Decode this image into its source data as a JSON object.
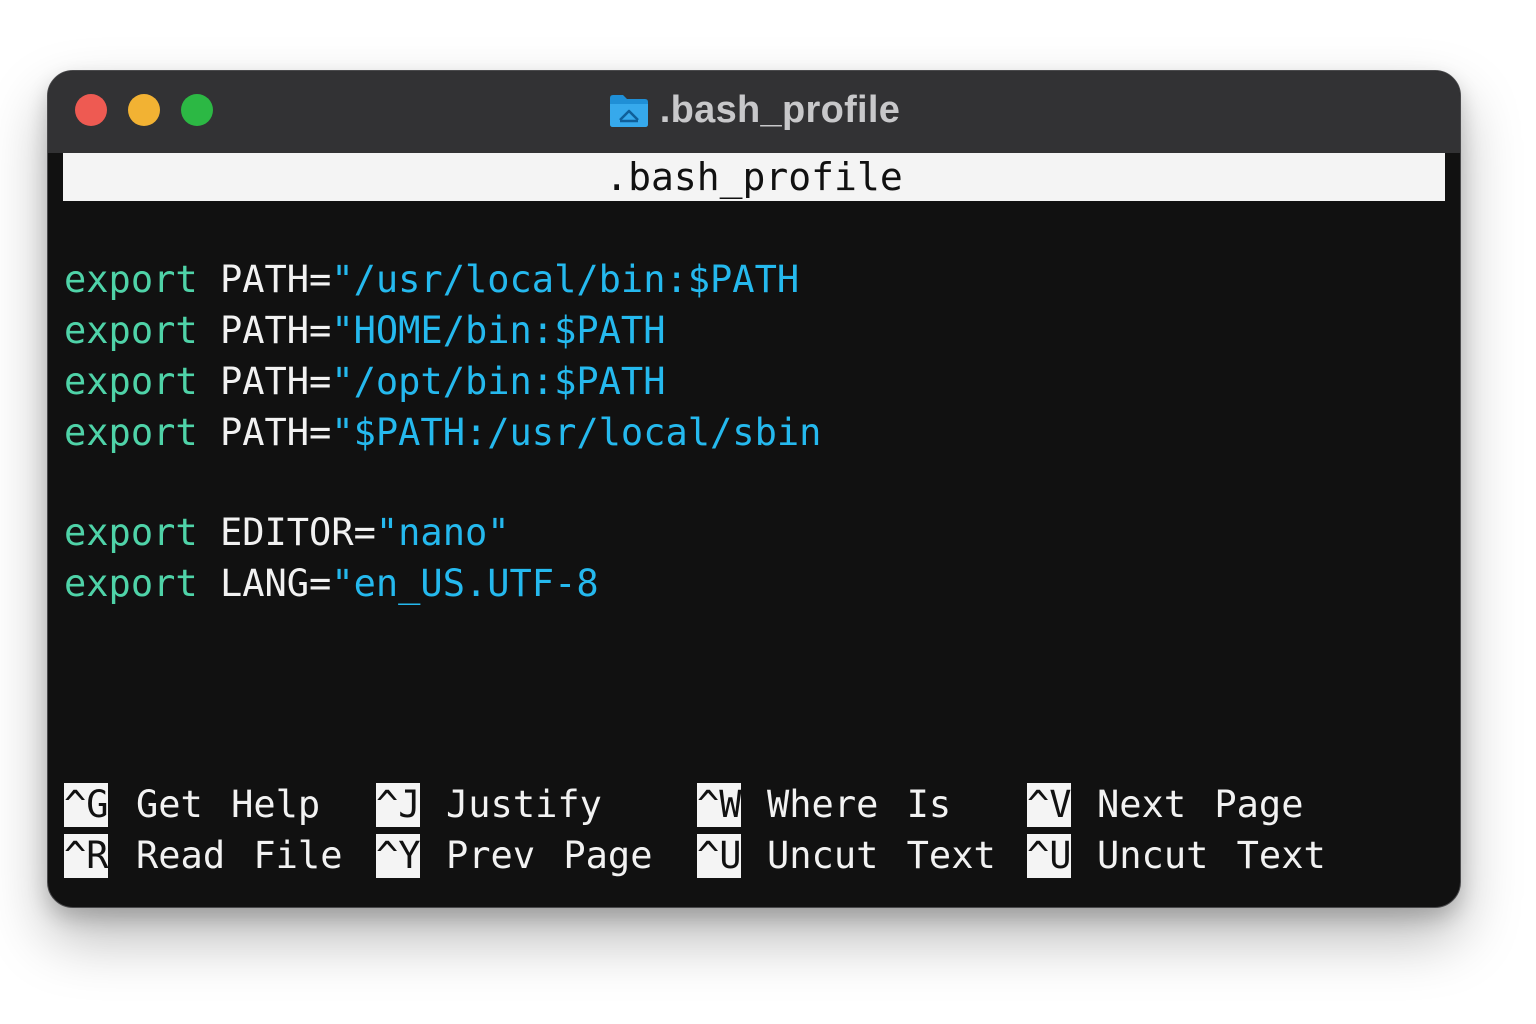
{
  "window": {
    "title": ".bash_profile",
    "folder_icon": "folder-icon"
  },
  "editor": {
    "header": ".bash_profile",
    "lines": [
      {
        "keyword": "export",
        "var": "PATH=",
        "value": "\"/usr/local/bin:$PATH"
      },
      {
        "keyword": "export",
        "var": "PATH=",
        "value": "\"HOME/bin:$PATH"
      },
      {
        "keyword": "export",
        "var": "PATH=",
        "value": "\"/opt/bin:$PATH"
      },
      {
        "keyword": "export",
        "var": "PATH=",
        "value": "\"$PATH:/usr/local/sbin"
      },
      {
        "keyword": "export",
        "var": "EDITOR=",
        "value": "\"nano\""
      },
      {
        "keyword": "export",
        "var": "LANG=",
        "value": "\"en_US.UTF-8"
      }
    ]
  },
  "shortcuts": [
    [
      {
        "key": "^G",
        "label": "Get Help"
      },
      {
        "key": "^J",
        "label": "Justify"
      },
      {
        "key": "^W",
        "label": "Where Is"
      },
      {
        "key": "^V",
        "label": "Next Page"
      }
    ],
    [
      {
        "key": "^R",
        "label": "Read File"
      },
      {
        "key": "^Y",
        "label": "Prev Page"
      },
      {
        "key": "^U",
        "label": "Uncut Text"
      },
      {
        "key": "^U",
        "label": "Uncut Text"
      }
    ]
  ],
  "colors": {
    "keyword": "#4fd3a8",
    "string": "#25b9ee",
    "text": "#f2f2f2",
    "background": "#111111",
    "titlebar": "#323234",
    "close": "#ee5a52",
    "minimize": "#f2b233",
    "zoom": "#2cb844"
  }
}
